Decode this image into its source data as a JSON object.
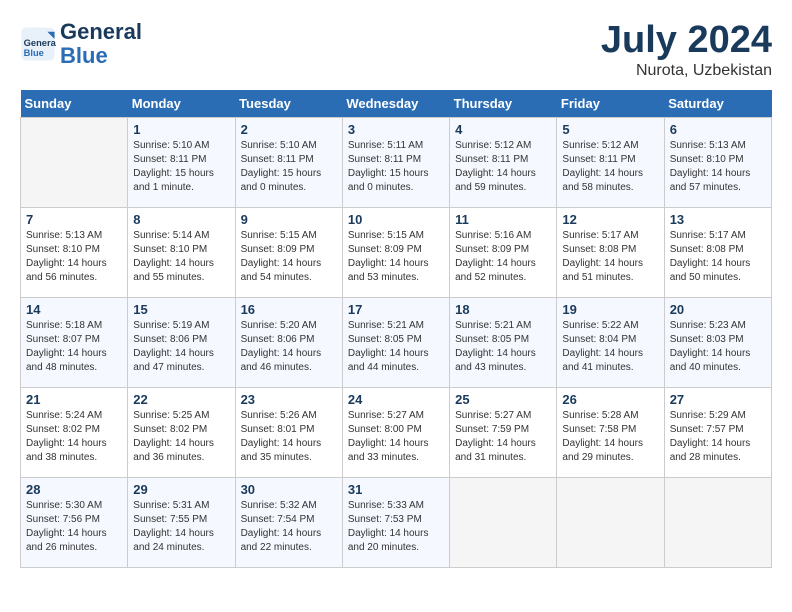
{
  "header": {
    "logo_line1": "General",
    "logo_line2": "Blue",
    "month_year": "July 2024",
    "location": "Nurota, Uzbekistan"
  },
  "days_of_week": [
    "Sunday",
    "Monday",
    "Tuesday",
    "Wednesday",
    "Thursday",
    "Friday",
    "Saturday"
  ],
  "weeks": [
    [
      {
        "day": "",
        "empty": true
      },
      {
        "day": "1",
        "sunrise": "5:10 AM",
        "sunset": "8:11 PM",
        "daylight": "15 hours and 1 minute."
      },
      {
        "day": "2",
        "sunrise": "5:10 AM",
        "sunset": "8:11 PM",
        "daylight": "15 hours and 0 minutes."
      },
      {
        "day": "3",
        "sunrise": "5:11 AM",
        "sunset": "8:11 PM",
        "daylight": "15 hours and 0 minutes."
      },
      {
        "day": "4",
        "sunrise": "5:12 AM",
        "sunset": "8:11 PM",
        "daylight": "14 hours and 59 minutes."
      },
      {
        "day": "5",
        "sunrise": "5:12 AM",
        "sunset": "8:11 PM",
        "daylight": "14 hours and 58 minutes."
      },
      {
        "day": "6",
        "sunrise": "5:13 AM",
        "sunset": "8:10 PM",
        "daylight": "14 hours and 57 minutes."
      }
    ],
    [
      {
        "day": "7",
        "sunrise": "5:13 AM",
        "sunset": "8:10 PM",
        "daylight": "14 hours and 56 minutes."
      },
      {
        "day": "8",
        "sunrise": "5:14 AM",
        "sunset": "8:10 PM",
        "daylight": "14 hours and 55 minutes."
      },
      {
        "day": "9",
        "sunrise": "5:15 AM",
        "sunset": "8:09 PM",
        "daylight": "14 hours and 54 minutes."
      },
      {
        "day": "10",
        "sunrise": "5:15 AM",
        "sunset": "8:09 PM",
        "daylight": "14 hours and 53 minutes."
      },
      {
        "day": "11",
        "sunrise": "5:16 AM",
        "sunset": "8:09 PM",
        "daylight": "14 hours and 52 minutes."
      },
      {
        "day": "12",
        "sunrise": "5:17 AM",
        "sunset": "8:08 PM",
        "daylight": "14 hours and 51 minutes."
      },
      {
        "day": "13",
        "sunrise": "5:17 AM",
        "sunset": "8:08 PM",
        "daylight": "14 hours and 50 minutes."
      }
    ],
    [
      {
        "day": "14",
        "sunrise": "5:18 AM",
        "sunset": "8:07 PM",
        "daylight": "14 hours and 48 minutes."
      },
      {
        "day": "15",
        "sunrise": "5:19 AM",
        "sunset": "8:06 PM",
        "daylight": "14 hours and 47 minutes."
      },
      {
        "day": "16",
        "sunrise": "5:20 AM",
        "sunset": "8:06 PM",
        "daylight": "14 hours and 46 minutes."
      },
      {
        "day": "17",
        "sunrise": "5:21 AM",
        "sunset": "8:05 PM",
        "daylight": "14 hours and 44 minutes."
      },
      {
        "day": "18",
        "sunrise": "5:21 AM",
        "sunset": "8:05 PM",
        "daylight": "14 hours and 43 minutes."
      },
      {
        "day": "19",
        "sunrise": "5:22 AM",
        "sunset": "8:04 PM",
        "daylight": "14 hours and 41 minutes."
      },
      {
        "day": "20",
        "sunrise": "5:23 AM",
        "sunset": "8:03 PM",
        "daylight": "14 hours and 40 minutes."
      }
    ],
    [
      {
        "day": "21",
        "sunrise": "5:24 AM",
        "sunset": "8:02 PM",
        "daylight": "14 hours and 38 minutes."
      },
      {
        "day": "22",
        "sunrise": "5:25 AM",
        "sunset": "8:02 PM",
        "daylight": "14 hours and 36 minutes."
      },
      {
        "day": "23",
        "sunrise": "5:26 AM",
        "sunset": "8:01 PM",
        "daylight": "14 hours and 35 minutes."
      },
      {
        "day": "24",
        "sunrise": "5:27 AM",
        "sunset": "8:00 PM",
        "daylight": "14 hours and 33 minutes."
      },
      {
        "day": "25",
        "sunrise": "5:27 AM",
        "sunset": "7:59 PM",
        "daylight": "14 hours and 31 minutes."
      },
      {
        "day": "26",
        "sunrise": "5:28 AM",
        "sunset": "7:58 PM",
        "daylight": "14 hours and 29 minutes."
      },
      {
        "day": "27",
        "sunrise": "5:29 AM",
        "sunset": "7:57 PM",
        "daylight": "14 hours and 28 minutes."
      }
    ],
    [
      {
        "day": "28",
        "sunrise": "5:30 AM",
        "sunset": "7:56 PM",
        "daylight": "14 hours and 26 minutes."
      },
      {
        "day": "29",
        "sunrise": "5:31 AM",
        "sunset": "7:55 PM",
        "daylight": "14 hours and 24 minutes."
      },
      {
        "day": "30",
        "sunrise": "5:32 AM",
        "sunset": "7:54 PM",
        "daylight": "14 hours and 22 minutes."
      },
      {
        "day": "31",
        "sunrise": "5:33 AM",
        "sunset": "7:53 PM",
        "daylight": "14 hours and 20 minutes."
      },
      {
        "day": "",
        "empty": true
      },
      {
        "day": "",
        "empty": true
      },
      {
        "day": "",
        "empty": true
      }
    ]
  ]
}
